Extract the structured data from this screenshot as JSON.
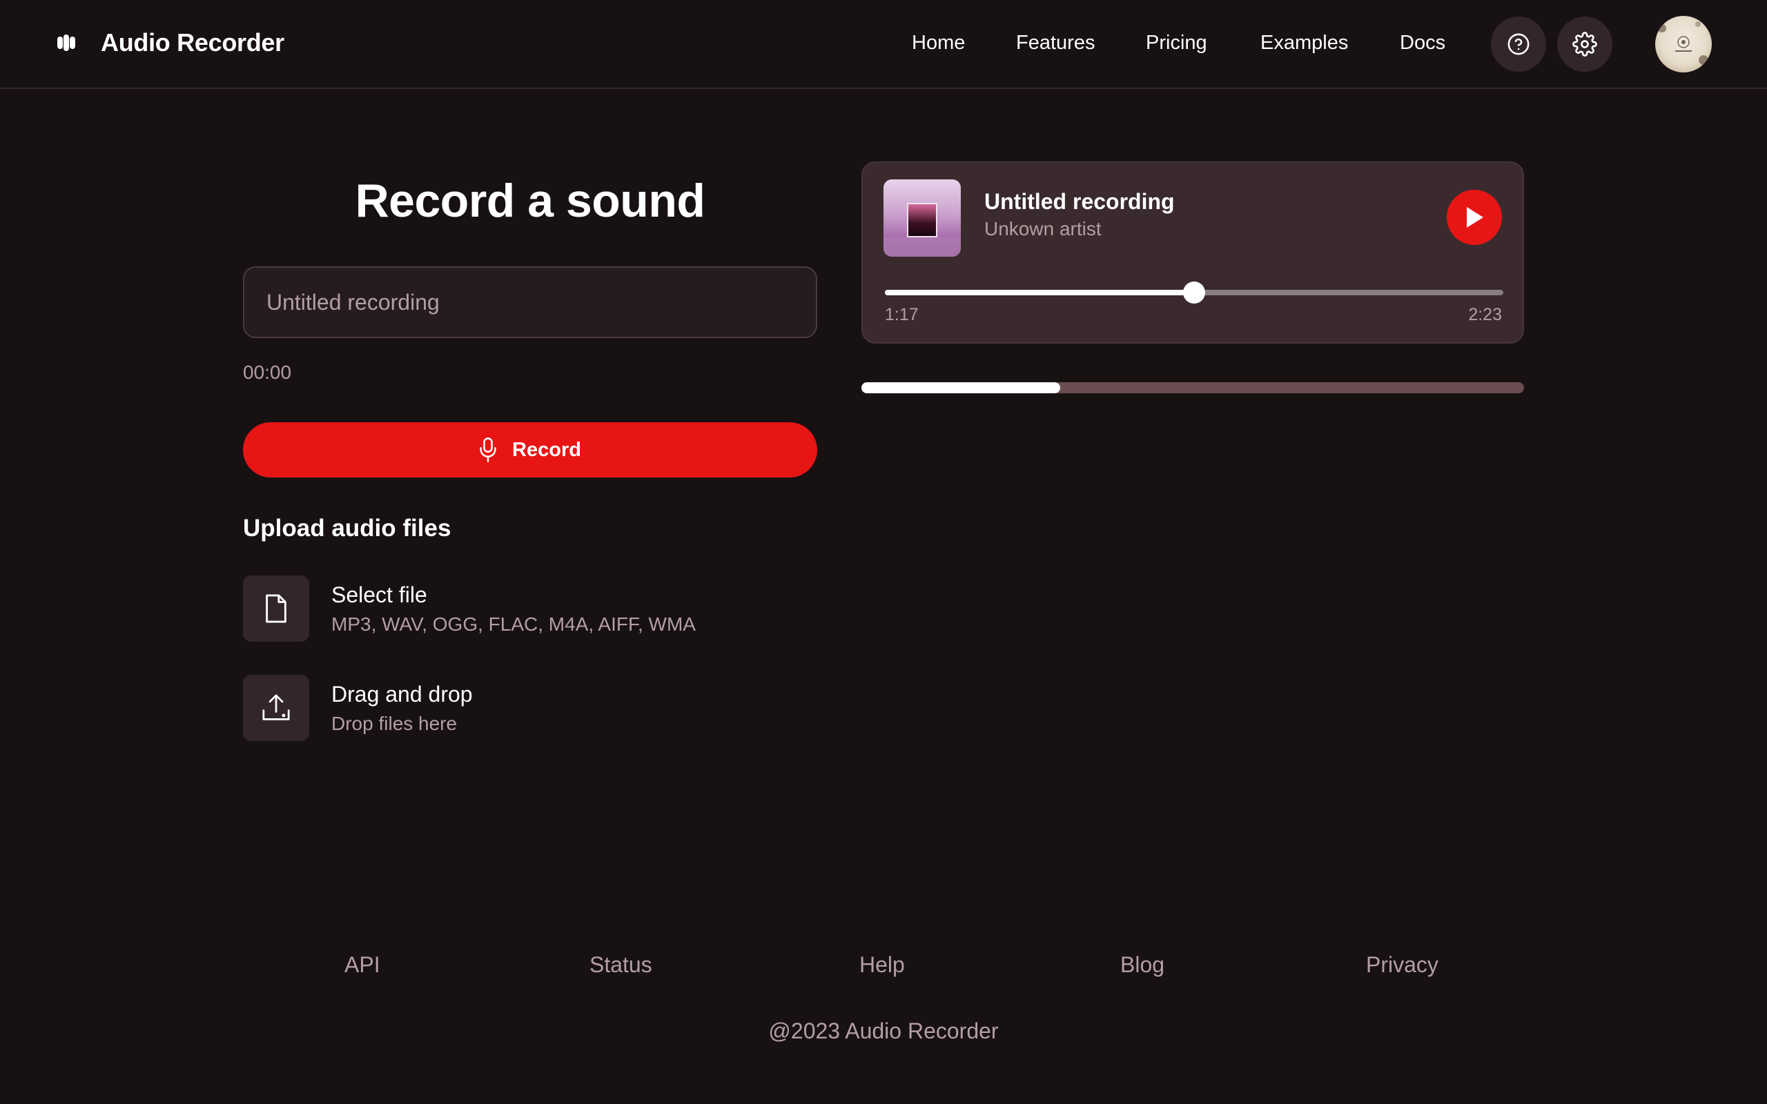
{
  "brand": {
    "name": "Audio Recorder",
    "logo_icon": "waveform-logo-icon"
  },
  "nav": {
    "items": [
      "Home",
      "Features",
      "Pricing",
      "Examples",
      "Docs"
    ]
  },
  "header_actions": {
    "help_icon": "help-circle-icon",
    "settings_icon": "gear-icon"
  },
  "recorder": {
    "title": "Record a sound",
    "name_placeholder": "Untitled recording",
    "timer": "00:00",
    "record_label": "Record"
  },
  "upload": {
    "heading": "Upload audio files",
    "items": [
      {
        "title": "Select file",
        "subtitle": "MP3, WAV, OGG, FLAC, M4A, AIFF, WMA",
        "icon": "file-icon"
      },
      {
        "title": "Drag and drop",
        "subtitle": "Drop files here",
        "icon": "upload-icon"
      }
    ]
  },
  "player": {
    "title": "Untitled recording",
    "artist": "Unkown artist",
    "current_time": "1:17",
    "total_time": "2:23",
    "position_fraction": 0.5,
    "play_icon": "play-icon"
  },
  "progress": {
    "fraction": 0.3
  },
  "footer": {
    "links": [
      "API",
      "Status",
      "Help",
      "Blog",
      "Privacy"
    ],
    "copyright": "@2023 Audio Recorder"
  },
  "colors": {
    "background": "#181112",
    "accent": "#e81515",
    "surface": "#33262a",
    "muted_text": "#b49ea4"
  }
}
